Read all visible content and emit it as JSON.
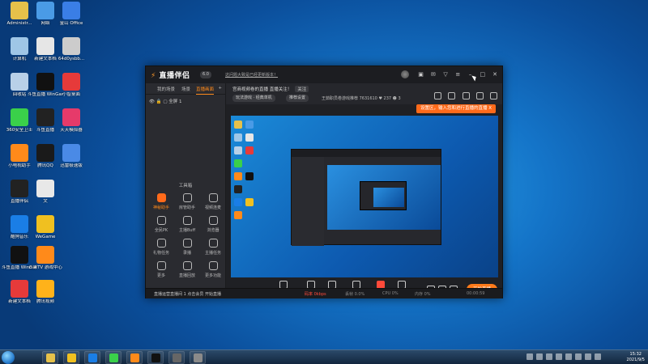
{
  "desktop": {
    "icons": [
      {
        "label": "Administr...",
        "color": "#e6c14a"
      },
      {
        "label": "网络",
        "color": "#4a9be6"
      },
      {
        "label": "金山 Office",
        "color": "#3a7ee6"
      },
      {
        "label": "计算机",
        "color": "#9fc6e6"
      },
      {
        "label": "新建文本档",
        "color": "#e6e6e6"
      },
      {
        "label": "64d0ysbb...",
        "color": "#cccccc"
      },
      {
        "label": "回收站",
        "color": "#b8d0e8"
      },
      {
        "label": "斗鱼直播 WinGame",
        "color": "#111111"
      },
      {
        "label": "小智桌面",
        "color": "#e63a3a"
      },
      {
        "label": "360安全卫士",
        "color": "#3ad04a"
      },
      {
        "label": "斗鱼直播",
        "color": "#222222"
      },
      {
        "label": "天天模拟器",
        "color": "#e63a6a"
      },
      {
        "label": "小电视助手",
        "color": "#ff8a1a"
      },
      {
        "label": "腾讯QQ",
        "color": "#1a1a1a"
      },
      {
        "label": "迅雷极速版",
        "color": "#4a8ae6"
      },
      {
        "label": "直播伴侣",
        "color": "#222222"
      },
      {
        "label": "文",
        "color": "#e8e8e8"
      },
      {
        "label": "酷狗音乐",
        "color": "#1a7ee6"
      },
      {
        "label": "WeGame",
        "color": "#f0c020"
      },
      {
        "label": "斗鱼直播 WinGame",
        "color": "#111111"
      },
      {
        "label": "芒果TV 游戏中心",
        "color": "#ff8a1a"
      },
      {
        "label": "新建文本档",
        "color": "#e63a3a"
      },
      {
        "label": "腾讯视频",
        "color": "#ffb21a"
      }
    ]
  },
  "taskbar": {
    "apps": [
      {
        "name": "explorer",
        "color": "#e6c14a"
      },
      {
        "name": "wegame",
        "color": "#f0c020"
      },
      {
        "name": "kugou",
        "color": "#1a7ee6"
      },
      {
        "name": "player",
        "color": "#3ad04a"
      },
      {
        "name": "douyin",
        "color": "#ff8a1a"
      },
      {
        "name": "qq",
        "color": "#111111"
      },
      {
        "name": "broadcast",
        "color": "#666666"
      },
      {
        "name": "streamer",
        "color": "#8a8a8a"
      }
    ],
    "time": "15:32",
    "date": "2021/9/5"
  },
  "app": {
    "logo_main": "直播伴侣",
    "logo_mark": "⚡",
    "version": "6.0",
    "notice": "这问题大致是已经更新版本！",
    "left": {
      "tabs": [
        "我的场景",
        "场景",
        "直播画面"
      ],
      "active_tab": 2,
      "scene_label": "全屏 1",
      "tools_header": "工具箱",
      "tools": [
        {
          "label": "神秘助手",
          "hot": true
        },
        {
          "label": "房管助手",
          "hot": false
        },
        {
          "label": "视频连麦",
          "hot": false
        },
        {
          "label": "全民PK",
          "hot": false
        },
        {
          "label": "主播Buff",
          "hot": false
        },
        {
          "label": "浏览器",
          "hot": false
        },
        {
          "label": "礼物任务",
          "hot": false
        },
        {
          "label": "录播",
          "hot": false
        },
        {
          "label": "主播任务",
          "hot": false
        },
        {
          "label": "更多",
          "hot": false
        },
        {
          "label": "直播回放",
          "hot": false
        },
        {
          "label": "更多功能",
          "hot": false
        }
      ]
    },
    "info": {
      "title": "宫商视频卷的直播 直播关注！",
      "follow": "关注",
      "category_pill": "玩法游戏 · 经典单机",
      "settings_pill": "推荐设置",
      "room": "王茹职员卷游戏推荐 7631610",
      "stat1": "237",
      "stat2": "3",
      "banner": "设置区，输入您和进行直播的直播  X"
    },
    "controls": [
      {
        "label": "直播屏幕",
        "red": false
      },
      {
        "label": "摄像头",
        "red": false
      },
      {
        "label": "手机投屏",
        "red": false
      },
      {
        "label": "多媒体",
        "red": false
      },
      {
        "label": "麦克风",
        "red": true
      },
      {
        "label": "扬声器",
        "red": false
      }
    ],
    "go_live": "开始直播",
    "status": {
      "tip": "直播运营直播间 1 点击会员 开始直播",
      "items": [
        "码率 0kbps",
        "丢帧 0.0%",
        "CPU 0%",
        "内存 0%",
        "00:00:59"
      ]
    }
  }
}
